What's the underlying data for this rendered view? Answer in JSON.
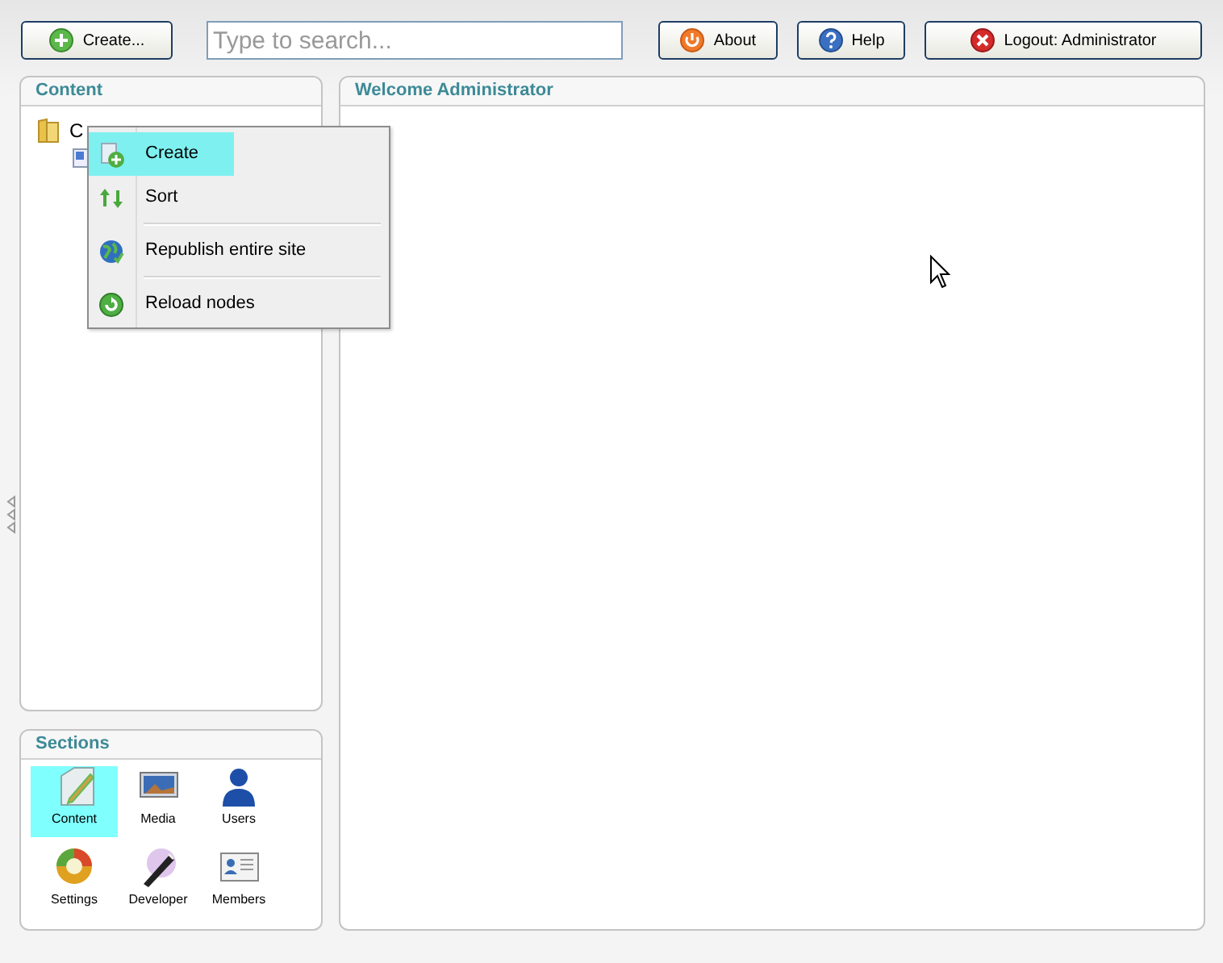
{
  "toolbar": {
    "create_button": "Create...",
    "search": {
      "placeholder": "Type to search..."
    },
    "buttons": [
      {
        "kind": "about",
        "label": "About"
      },
      {
        "kind": "help",
        "label": "Help"
      },
      {
        "kind": "logout",
        "label": "Logout: Administrator"
      }
    ]
  },
  "content_panel": {
    "title": "Content",
    "tree": [
      {
        "label": "C",
        "children": [
          {
            "kind": "document"
          }
        ]
      }
    ]
  },
  "context_menu": {
    "items": [
      {
        "kind": "create",
        "label": "Create",
        "selected": true,
        "separator_before": false
      },
      {
        "kind": "sort",
        "label": "Sort",
        "selected": false,
        "separator_before": false
      },
      {
        "kind": "republish",
        "label": "Republish entire site",
        "selected": false,
        "separator_before": true
      },
      {
        "kind": "reload",
        "label": "Reload nodes",
        "selected": false,
        "separator_before": true
      }
    ]
  },
  "main_panel": {
    "title": "Welcome Administrator"
  },
  "sections_panel": {
    "title": "Sections",
    "items": [
      {
        "kind": "content",
        "label": "Content",
        "selected": true
      },
      {
        "kind": "media",
        "label": "Media",
        "selected": false
      },
      {
        "kind": "users",
        "label": "Users",
        "selected": false
      },
      {
        "kind": "settings",
        "label": "Settings",
        "selected": false
      },
      {
        "kind": "developer",
        "label": "Developer",
        "selected": false
      },
      {
        "kind": "members",
        "label": "Members",
        "selected": false
      }
    ]
  }
}
